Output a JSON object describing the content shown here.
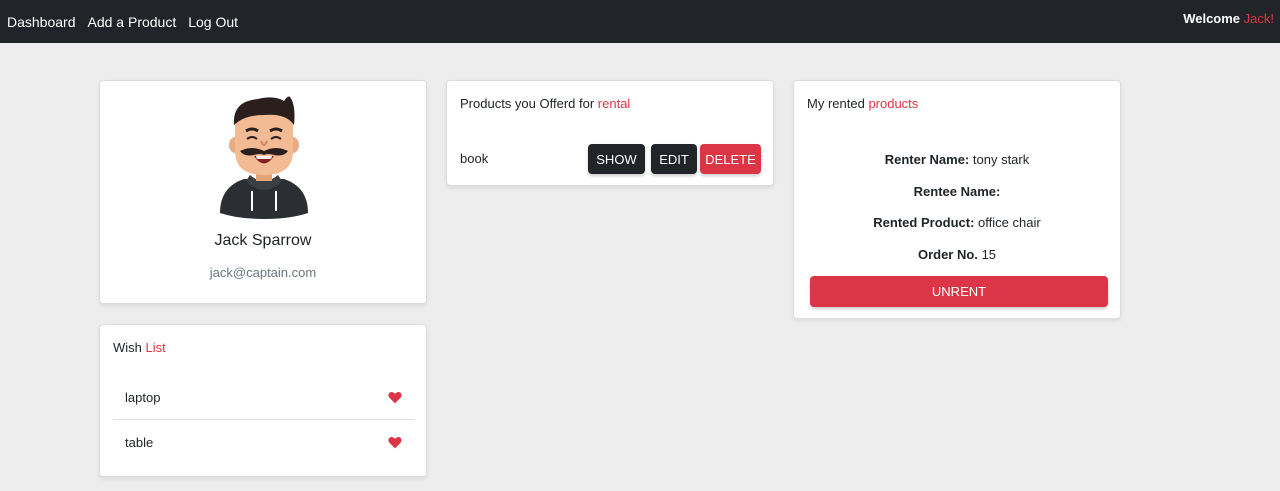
{
  "nav": {
    "links": [
      "Dashboard",
      "Add a Product",
      "Log Out"
    ],
    "welcome_label": "Welcome",
    "welcome_name": "Jack!"
  },
  "profile": {
    "name": "Jack Sparrow",
    "email": "jack@captain.com",
    "avatar_icon": "cartoon-man-mustache-avatar"
  },
  "wishlist": {
    "title_plain": "Wish",
    "title_accent": "List",
    "items": [
      {
        "label": "laptop",
        "icon": "heart-icon"
      },
      {
        "label": "table",
        "icon": "heart-icon"
      }
    ]
  },
  "offered": {
    "title_plain": "Products you Offerd for",
    "title_accent": "rental",
    "products": [
      {
        "name": "book",
        "show_label": "SHOW",
        "edit_label": "EDIT",
        "delete_label": "DELETE"
      }
    ]
  },
  "rented": {
    "title_plain": "My rented",
    "title_accent": "products",
    "renter_label": "Renter Name:",
    "renter_value": "tony stark",
    "rentee_label": "Rentee Name:",
    "rentee_value": "",
    "product_label": "Rented Product:",
    "product_value": "office chair",
    "order_label": "Order No.",
    "order_value": "15",
    "unrent_label": "UNRENT"
  },
  "colors": {
    "navbar": "#212529",
    "accent": "#dc3545",
    "background": "#ededed"
  }
}
